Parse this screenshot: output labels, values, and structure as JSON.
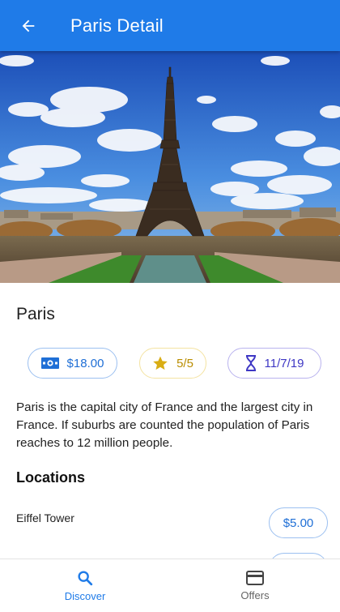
{
  "appbar": {
    "title": "Paris Detail",
    "back_icon": "arrow-back-icon"
  },
  "hero": {
    "image_subject": "Eiffel Tower under blue sky with clouds"
  },
  "city": {
    "name": "Paris"
  },
  "chips": {
    "price": {
      "label": "$18.00",
      "icon": "money-icon"
    },
    "rating": {
      "label": "5/5",
      "icon": "star-icon"
    },
    "date": {
      "label": "11/7/19",
      "icon": "hourglass-icon"
    }
  },
  "description": "Paris is the capital city of France and the largest city in France. If suburbs are counted the population of Paris reaches to 12 million people.",
  "locations": {
    "title": "Locations",
    "items": [
      {
        "name": "Eiffel Tower",
        "price": "$5.00"
      },
      {
        "name": "",
        "price": ""
      }
    ]
  },
  "bottom_nav": {
    "items": [
      {
        "label": "Discover",
        "icon": "search-icon",
        "active": true
      },
      {
        "label": "Offers",
        "icon": "card-icon",
        "active": false
      }
    ]
  },
  "colors": {
    "primary": "#1f7be8",
    "price": "#1f6fd6",
    "rating": "#b98d00",
    "date": "#3e37c4"
  }
}
